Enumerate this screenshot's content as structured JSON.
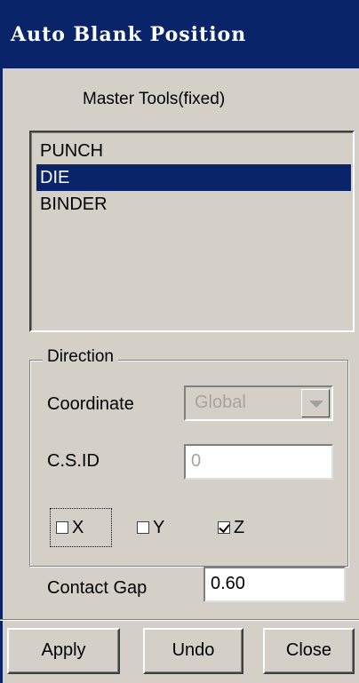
{
  "window": {
    "title": "Auto Blank Position"
  },
  "master_tools": {
    "label": "Master Tools(fixed)",
    "items": [
      {
        "label": "PUNCH",
        "selected": false
      },
      {
        "label": "DIE",
        "selected": true
      },
      {
        "label": "BINDER",
        "selected": false
      }
    ]
  },
  "direction": {
    "legend": "Direction",
    "coordinate": {
      "label": "Coordinate",
      "value": "Global",
      "enabled": false
    },
    "csid": {
      "label": "C.S.ID",
      "value": "0",
      "enabled": false
    },
    "axes": [
      {
        "label": "X",
        "checked": false
      },
      {
        "label": "Y",
        "checked": false
      },
      {
        "label": "Z",
        "checked": true
      }
    ]
  },
  "contact_gap": {
    "label": "Contact Gap",
    "value": "0.60"
  },
  "buttons": {
    "apply": "Apply",
    "undo": "Undo",
    "close": "Close"
  },
  "colors": {
    "titlebar": "#0a246a",
    "face": "#d4d0c8",
    "selection": "#0a246a"
  }
}
